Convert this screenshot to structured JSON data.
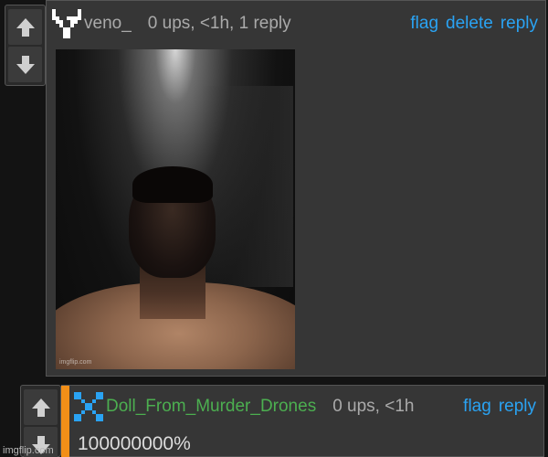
{
  "comment1": {
    "username": "veno_",
    "username_color": "#aaaaaa",
    "meta": "0 ups, <1h, 1 reply",
    "actions": [
      "flag",
      "delete",
      "reply"
    ],
    "image_watermark": "imgflip.com"
  },
  "comment2": {
    "username": "Doll_From_Murder_Drones",
    "username_color": "#4caf50",
    "meta": "0 ups, <1h",
    "actions": [
      "flag",
      "reply"
    ],
    "text": "100000000%"
  },
  "footer": {
    "watermark": "imgflip.com"
  },
  "colors": {
    "link": "#2aa3f3",
    "accent": "#f28f18",
    "panel": "#363636"
  }
}
